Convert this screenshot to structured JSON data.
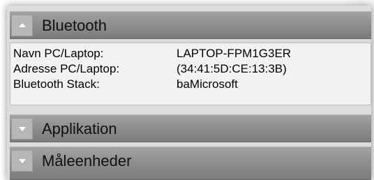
{
  "sections": [
    {
      "title": "Bluetooth",
      "expanded": true,
      "icon": "chevron-up-icon"
    },
    {
      "title": "Applikation",
      "expanded": false,
      "icon": "chevron-down-icon"
    },
    {
      "title": "Måleenheder",
      "expanded": false,
      "icon": "chevron-down-icon"
    }
  ],
  "bluetooth": {
    "rows": [
      {
        "key": "Navn PC/Laptop:",
        "value": "LAPTOP-FPM1G3ER"
      },
      {
        "key": "Adresse PC/Laptop:",
        "value": "(34:41:5D:CE:13:3B)"
      },
      {
        "key": "Bluetooth Stack:",
        "value": "baMicrosoft"
      }
    ]
  },
  "colors": {
    "header_bg": "#8f8f8f",
    "panel_bg": "#dcdcdc",
    "details_bg": "#f2f2f2",
    "toggle_bg": "#b7b7b7",
    "chevron": "#ffffff"
  }
}
